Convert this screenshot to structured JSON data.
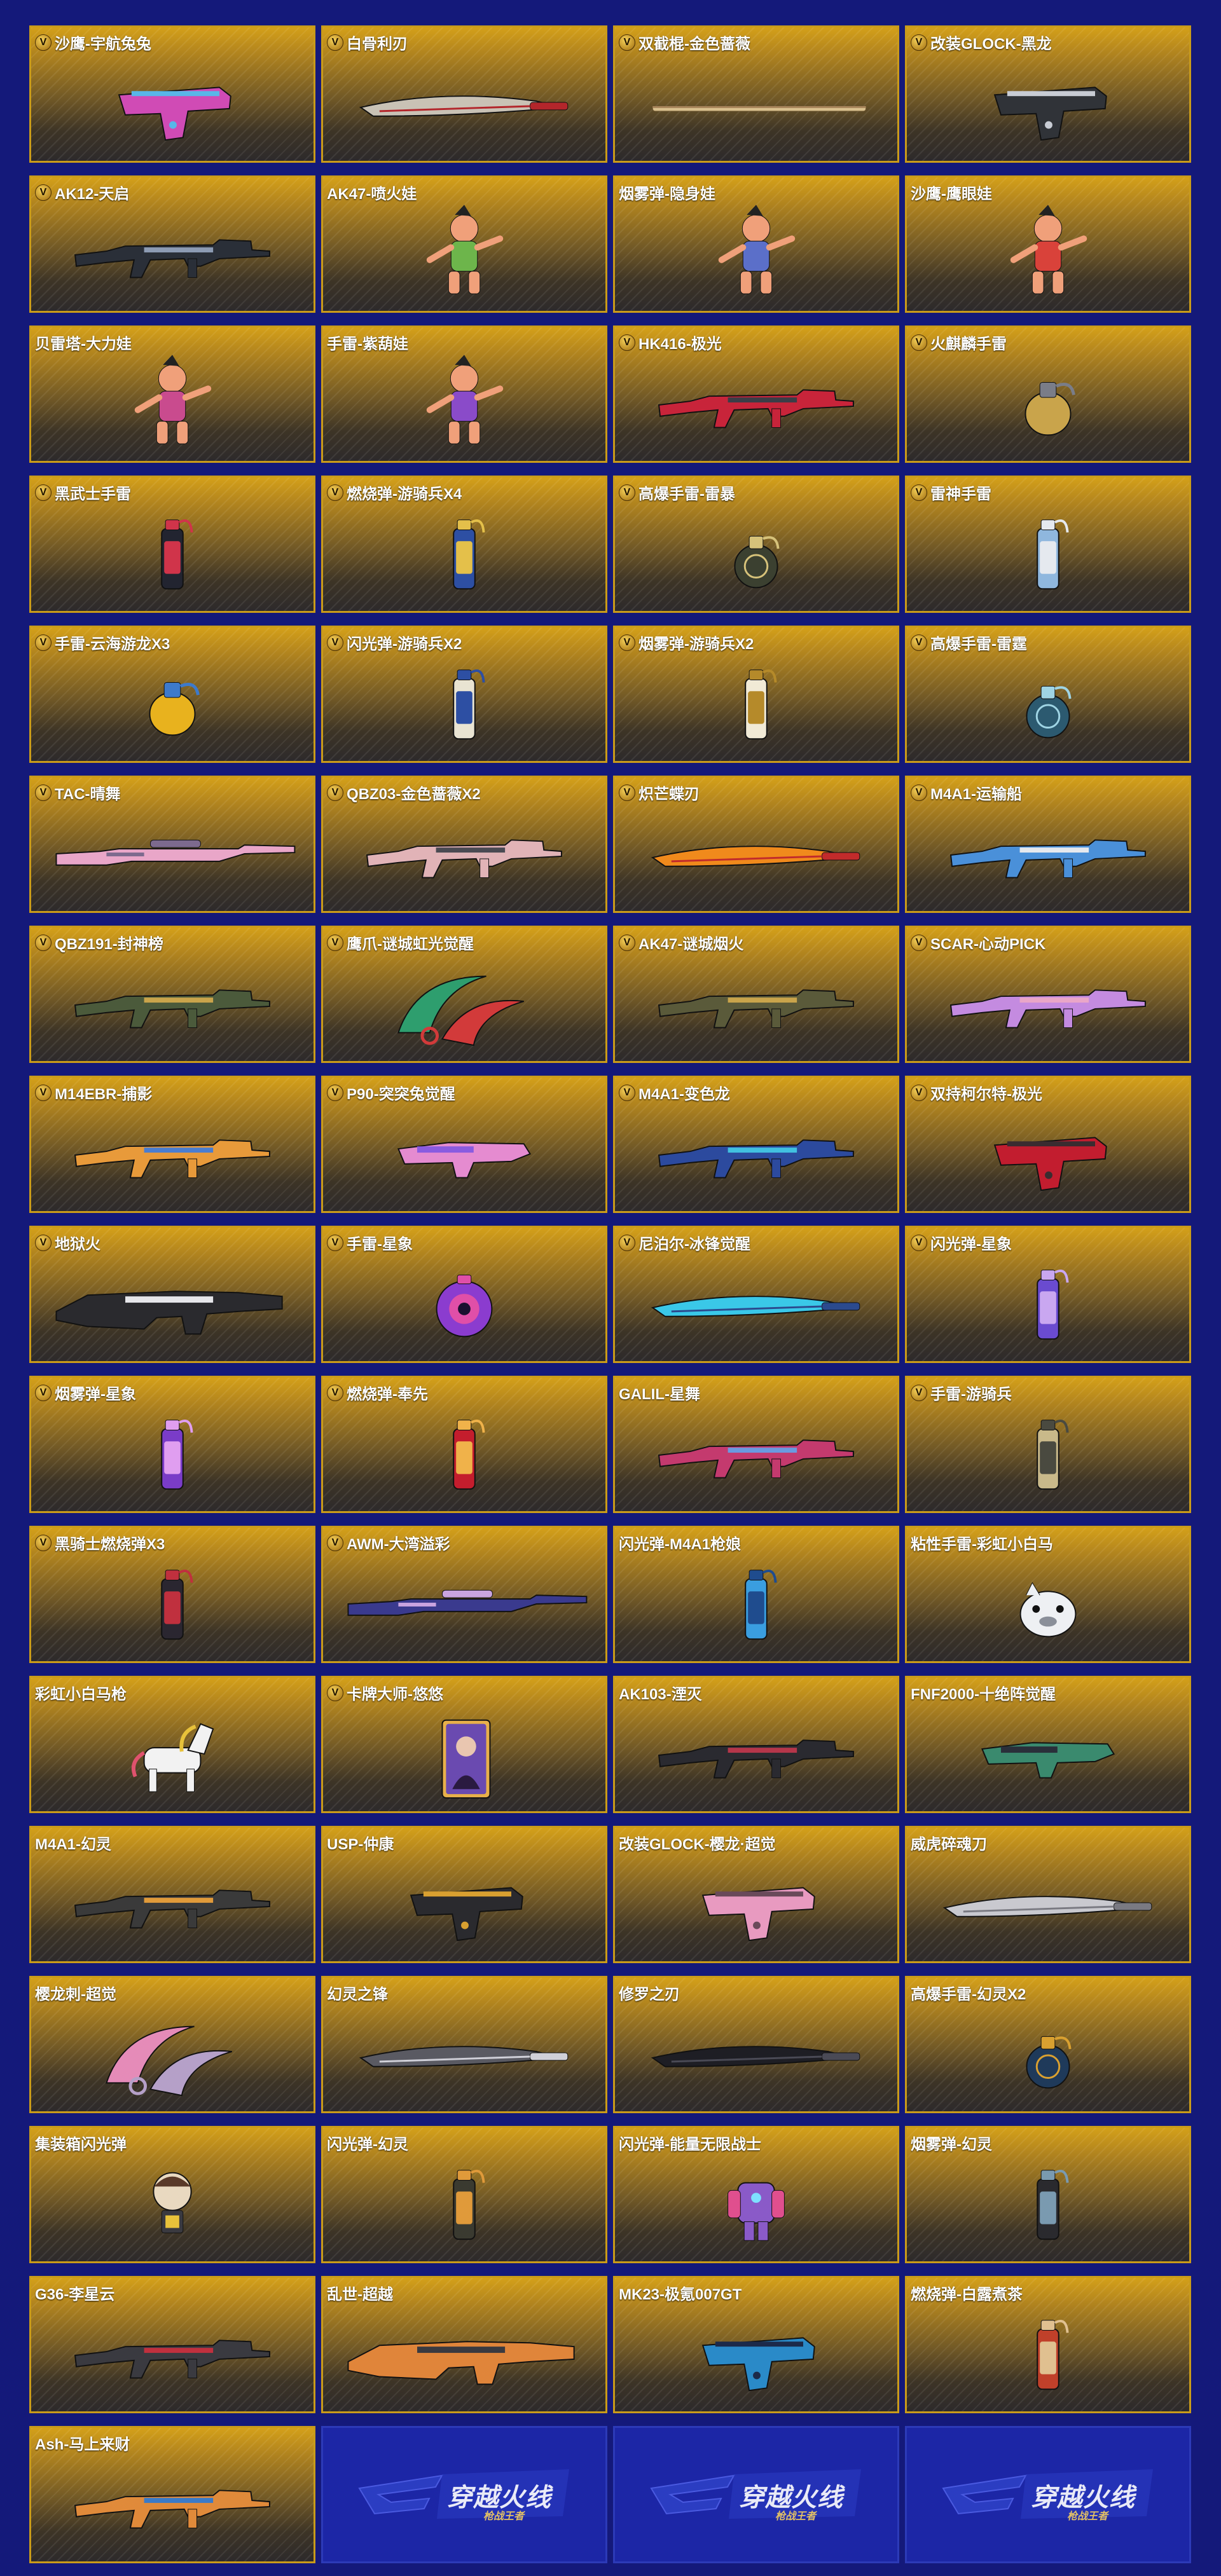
{
  "items": [
    {
      "name": "沙鹰-宇航兔兔",
      "badge": true,
      "kind": "pistol",
      "c": [
        "#d04bb5",
        "#59b6e8"
      ]
    },
    {
      "name": "白骨利刃",
      "badge": true,
      "kind": "blade",
      "c": [
        "#c9c2b5",
        "#b3262b"
      ]
    },
    {
      "name": "双截棍-金色蔷薇",
      "badge": true,
      "kind": "staff",
      "c": [
        "#d9c08e",
        "#a7845a"
      ]
    },
    {
      "name": "改装GLOCK-黑龙",
      "badge": true,
      "kind": "pistol",
      "c": [
        "#303338",
        "#c8ccd4"
      ]
    },
    {
      "name": "AK12-天启",
      "badge": true,
      "kind": "rifle",
      "c": [
        "#2a2f38",
        "#8d9bb3"
      ]
    },
    {
      "name": "AK47-喷火娃",
      "badge": false,
      "kind": "figure",
      "c": [
        "#6db54b",
        "#f0a07a"
      ]
    },
    {
      "name": "烟雾弹-隐身娃",
      "badge": false,
      "kind": "figure",
      "c": [
        "#5b6fc9",
        "#f0a07a"
      ]
    },
    {
      "name": "沙鹰-鹰眼娃",
      "badge": false,
      "kind": "figure",
      "c": [
        "#d9423a",
        "#f0a07a"
      ]
    },
    {
      "name": "贝雷塔-大力娃",
      "badge": false,
      "kind": "figure",
      "c": [
        "#c94b8e",
        "#f0a07a"
      ]
    },
    {
      "name": "手雷-紫葫娃",
      "badge": false,
      "kind": "figure",
      "c": [
        "#8a4bc9",
        "#f0a07a"
      ]
    },
    {
      "name": "HK416-极光",
      "badge": true,
      "kind": "rifle",
      "c": [
        "#c8243a",
        "#3b3d47"
      ]
    },
    {
      "name": "火麒麟手雷",
      "badge": true,
      "kind": "grenade",
      "c": [
        "#c9a44b",
        "#7a7d88"
      ]
    },
    {
      "name": "黑武士手雷",
      "badge": true,
      "kind": "canister",
      "c": [
        "#222430",
        "#d0344a"
      ]
    },
    {
      "name": "燃烧弹-游骑兵X4",
      "badge": true,
      "kind": "canister",
      "c": [
        "#2d4fa3",
        "#e4c04a"
      ]
    },
    {
      "name": "高爆手雷-雷暴",
      "badge": true,
      "kind": "frag",
      "c": [
        "#3b4030",
        "#d6c27a"
      ]
    },
    {
      "name": "雷神手雷",
      "badge": true,
      "kind": "canister",
      "c": [
        "#8fb7de",
        "#e5e9ef"
      ]
    },
    {
      "name": "手雷-云海游龙X3",
      "badge": true,
      "kind": "grenade",
      "c": [
        "#e8b21e",
        "#3d7acb"
      ]
    },
    {
      "name": "闪光弹-游骑兵X2",
      "badge": true,
      "kind": "canister",
      "c": [
        "#e9e4d2",
        "#2d4fa3"
      ]
    },
    {
      "name": "烟雾弹-游骑兵X2",
      "badge": true,
      "kind": "canister",
      "c": [
        "#f1ead6",
        "#b58a2a"
      ]
    },
    {
      "name": "高爆手雷-雷霆",
      "badge": true,
      "kind": "frag",
      "c": [
        "#2c5a70",
        "#9fd4e4"
      ]
    },
    {
      "name": "TAC-晴舞",
      "badge": true,
      "kind": "sniper",
      "c": [
        "#e9a6c8",
        "#7d6a8e"
      ]
    },
    {
      "name": "QBZ03-金色蔷薇X2",
      "badge": true,
      "kind": "rifle",
      "c": [
        "#e1b3b7",
        "#4a4a52"
      ]
    },
    {
      "name": "炽芒蝶刃",
      "badge": true,
      "kind": "blade",
      "c": [
        "#f08a1c",
        "#c22b2b"
      ]
    },
    {
      "name": "M4A1-运输船",
      "badge": true,
      "kind": "rifle",
      "c": [
        "#4a90d9",
        "#e6e9ee"
      ]
    },
    {
      "name": "QBZ191-封神榜",
      "badge": true,
      "kind": "rifle",
      "c": [
        "#4b5a3b",
        "#c9a44b"
      ]
    },
    {
      "name": "鹰爪-谜城虹光觉醒",
      "badge": true,
      "kind": "claw",
      "c": [
        "#2e9e6e",
        "#d23a3a"
      ]
    },
    {
      "name": "AK47-谜城烟火",
      "badge": true,
      "kind": "rifle",
      "c": [
        "#5a5a3a",
        "#c9a44b"
      ]
    },
    {
      "name": "SCAR-心动PICK",
      "badge": true,
      "kind": "rifle",
      "c": [
        "#c48be0",
        "#e9a6c8"
      ]
    },
    {
      "name": "M14EBR-捕影",
      "badge": true,
      "kind": "rifle",
      "c": [
        "#e89a3a",
        "#4a7dd0"
      ]
    },
    {
      "name": "P90-突突兔觉醒",
      "badge": true,
      "kind": "smg",
      "c": [
        "#e58bd0",
        "#8a5be0"
      ]
    },
    {
      "name": "M4A1-变色龙",
      "badge": true,
      "kind": "rifle",
      "c": [
        "#2c4a9e",
        "#41c0e0"
      ]
    },
    {
      "name": "双持柯尔特-极光",
      "badge": true,
      "kind": "pistol",
      "c": [
        "#c21d2f",
        "#3a2c30"
      ]
    },
    {
      "name": "地狱火",
      "badge": true,
      "kind": "heavy",
      "c": [
        "#2a2a2e",
        "#e6e6ea"
      ]
    },
    {
      "name": "手雷-星象",
      "badge": true,
      "kind": "orb",
      "c": [
        "#8b3ccf",
        "#e04fa8"
      ]
    },
    {
      "name": "尼泊尔-冰锋觉醒",
      "badge": true,
      "kind": "blade",
      "c": [
        "#3ac8e8",
        "#2b4a8e"
      ]
    },
    {
      "name": "闪光弹-星象",
      "badge": true,
      "kind": "canister",
      "c": [
        "#6a4bd0",
        "#c9a7f0"
      ]
    },
    {
      "name": "烟雾弹-星象",
      "badge": true,
      "kind": "canister",
      "c": [
        "#7a3cc8",
        "#e09ef0"
      ]
    },
    {
      "name": "燃烧弹-奉先",
      "badge": true,
      "kind": "canister",
      "c": [
        "#c41d2d",
        "#f0b24a"
      ]
    },
    {
      "name": "GALIL-星舞",
      "badge": false,
      "kind": "rifle",
      "c": [
        "#c43a6e",
        "#6a9ae0"
      ]
    },
    {
      "name": "手雷-游骑兵",
      "badge": true,
      "kind": "canister",
      "c": [
        "#c9b98a",
        "#4a4a40"
      ]
    },
    {
      "name": "黑骑士燃烧弹X3",
      "badge": true,
      "kind": "canister",
      "c": [
        "#2a2630",
        "#c0303e"
      ]
    },
    {
      "name": "AWM-大湾溢彩",
      "badge": true,
      "kind": "sniper",
      "c": [
        "#3a3a8e",
        "#c9a4e0"
      ]
    },
    {
      "name": "闪光弹-M4A1枪娘",
      "badge": false,
      "kind": "canister",
      "c": [
        "#3a9ee0",
        "#1f4c8e"
      ]
    },
    {
      "name": "粘性手雷-彩虹小白马",
      "badge": false,
      "kind": "critter",
      "c": [
        "#eef0f3",
        "#8a8f99"
      ]
    },
    {
      "name": "彩虹小白马枪",
      "badge": false,
      "kind": "horse",
      "c": [
        "#f2f2f2",
        "#e8c23a"
      ]
    },
    {
      "name": "卡牌大师-悠悠",
      "badge": true,
      "kind": "card",
      "c": [
        "#6a4ab0",
        "#e8b04a"
      ]
    },
    {
      "name": "AK103-湮灭",
      "badge": false,
      "kind": "rifle",
      "c": [
        "#2a2a30",
        "#b5364a"
      ]
    },
    {
      "name": "FNF2000-十绝阵觉醒",
      "badge": false,
      "kind": "smg",
      "c": [
        "#3a8a6e",
        "#2a2f3a"
      ]
    },
    {
      "name": "M4A1-幻灵",
      "badge": false,
      "kind": "rifle",
      "c": [
        "#3a3a3a",
        "#e09a3a"
      ]
    },
    {
      "name": "USP-仲康",
      "badge": false,
      "kind": "pistol",
      "c": [
        "#2a2a2e",
        "#d9a030"
      ]
    },
    {
      "name": "改装GLOCK-樱龙·超觉",
      "badge": false,
      "kind": "pistol",
      "c": [
        "#e89ac0",
        "#6a4a5a"
      ]
    },
    {
      "name": "威虎碎魂刀",
      "badge": false,
      "kind": "blade",
      "c": [
        "#c9c9cf",
        "#7a7a82"
      ]
    },
    {
      "name": "樱龙刺-超觉",
      "badge": false,
      "kind": "claw",
      "c": [
        "#e58bb8",
        "#b5a0c8"
      ]
    },
    {
      "name": "幻灵之锋",
      "badge": false,
      "kind": "blade",
      "c": [
        "#5a5a62",
        "#d0d0d8"
      ]
    },
    {
      "name": "修罗之刃",
      "badge": false,
      "kind": "blade",
      "c": [
        "#1e1e24",
        "#4a4a55"
      ]
    },
    {
      "name": "高爆手雷-幻灵X2",
      "badge": false,
      "kind": "frag",
      "c": [
        "#1f3a5a",
        "#d9a030"
      ]
    },
    {
      "name": "集装箱闪光弹",
      "badge": false,
      "kind": "chibi",
      "c": [
        "#e9d9c0",
        "#3a3a40"
      ]
    },
    {
      "name": "闪光弹-幻灵",
      "badge": false,
      "kind": "canister",
      "c": [
        "#3a3a30",
        "#e09a3a"
      ]
    },
    {
      "name": "闪光弹-能量无限战士",
      "badge": false,
      "kind": "mech",
      "c": [
        "#8a5ac8",
        "#e04f8e"
      ]
    },
    {
      "name": "烟雾弹-幻灵",
      "badge": false,
      "kind": "canister",
      "c": [
        "#2a2a2e",
        "#7a9ab0"
      ]
    },
    {
      "name": "G36-李星云",
      "badge": false,
      "kind": "rifle",
      "c": [
        "#3a3a40",
        "#c0303e"
      ]
    },
    {
      "name": "乱世-超越",
      "badge": false,
      "kind": "heavy",
      "c": [
        "#e0853a",
        "#3a3a40"
      ]
    },
    {
      "name": "MK23-极氪007GT",
      "badge": false,
      "kind": "pistol",
      "c": [
        "#2a8ac8",
        "#1c2a4a"
      ]
    },
    {
      "name": "燃烧弹-白露煮茶",
      "badge": false,
      "kind": "canister",
      "c": [
        "#c0402a",
        "#e0c090"
      ]
    },
    {
      "name": "Ash-马上来财",
      "badge": false,
      "kind": "rifle",
      "c": [
        "#e08a3a",
        "#3a7ac8"
      ]
    }
  ],
  "brand": {
    "title": "穿越火线",
    "subtitle": "枪战王者",
    "slots": 3
  },
  "colors": {
    "background": "#14197a",
    "card_border": "#c99b1a",
    "card_gold": "#d4a019",
    "blank_card": "#1c26a6",
    "brand_blue": "#2b3dc2"
  }
}
